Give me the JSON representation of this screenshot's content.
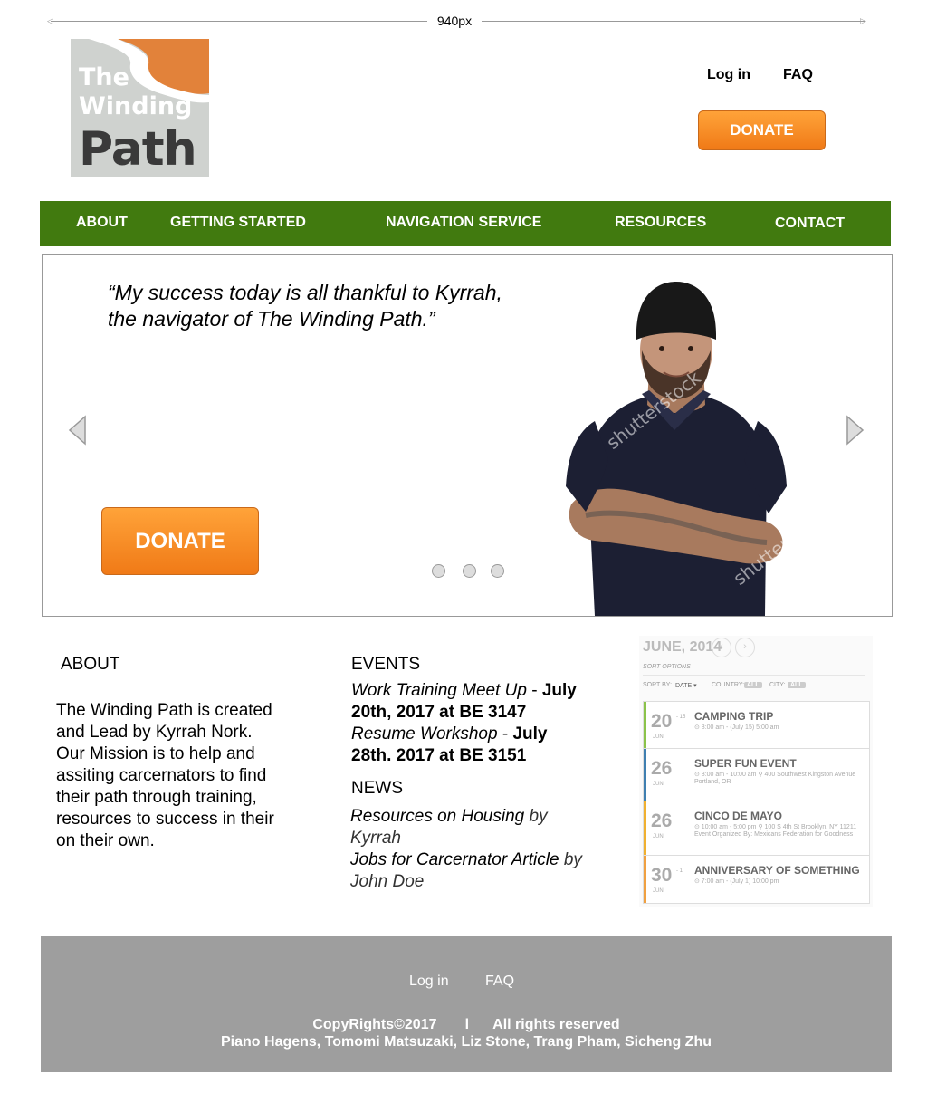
{
  "ruler": {
    "label": "940px"
  },
  "logo": {
    "line1": "The",
    "line2": "Winding",
    "line3": "Path"
  },
  "header": {
    "login": "Log in",
    "faq": "FAQ",
    "donate": "DONATE"
  },
  "nav": {
    "about": "ABOUT",
    "getting_started": "GETTING STARTED",
    "navigation_service": "NAVIGATION SERVICE",
    "resources": "RESOURCES",
    "contact": "CONTACT"
  },
  "hero": {
    "quote_line1": "“My success today is all thankful to Kyrrah,",
    "quote_line2": "the navigator of The Winding Path.”",
    "donate": "DONATE",
    "watermark": "shutterstock"
  },
  "about": {
    "heading": "ABOUT",
    "body": "The Winding Path is created and Lead by Kyrrah Nork.",
    "mission": "Our Mission is to help and assiting carcernators to find their path through training, resources to success in their on their own."
  },
  "events": {
    "heading": "EVENTS",
    "items": [
      {
        "name": "Work Training Meet Up",
        "sep": " - ",
        "when": "July 20th, 2017 at BE 3147"
      },
      {
        "name": "Resume Workshop",
        "sep": " - ",
        "when": "July 28th. 2017 at BE 3151"
      }
    ]
  },
  "news": {
    "heading": "NEWS",
    "items": [
      {
        "title": "Resources on Housing",
        "by": " by Kyrrah"
      },
      {
        "title": "Jobs for Carcernator Article",
        "by": " by John Doe"
      }
    ]
  },
  "calendar": {
    "month": "JUNE, 2014",
    "sort_options": "SORT OPTIONS",
    "sort_by": "SORT BY:",
    "sort_value": "DATE ▾",
    "country": "COUNTRY:",
    "country_value": "ALL",
    "city": "CITY:",
    "city_value": "ALL",
    "events": [
      {
        "day": "20",
        "day2": "- 15",
        "month": "JUN",
        "title": "CAMPING TRIP",
        "meta": "⊙ 8:00 am - (July 15) 5:00 am",
        "color": "#8bc34a"
      },
      {
        "day": "26",
        "day2": "",
        "month": "JUN",
        "title": "SUPER FUN EVENT",
        "meta": "⊙ 8:00 am - 10:00 am  ⚲ 400 Southwest Kingston Avenue Portland, OR",
        "color": "#3f7fb0"
      },
      {
        "day": "26",
        "day2": "",
        "month": "JUN",
        "title": "CINCO DE MAYO",
        "meta": "⊙ 10:00 am - 5:00 pm  ⚲ 100 S 4th St Brooklyn, NY 11211  Event Organized By: Mexicans Federation for Goodness",
        "color": "#f0b030"
      },
      {
        "day": "30",
        "day2": "- 1",
        "month": "JUN",
        "title": "ANNIVERSARY OF SOMETHING",
        "meta": "⊙ 7:00 am - (July 1) 10:00 pm",
        "color": "#f0a040"
      }
    ]
  },
  "footer": {
    "login": "Log in",
    "faq": "FAQ",
    "copyright": "CopyRights©2017       l      All rights reserved",
    "names": "Piano Hagens, Tomomi Matsuzaki, Liz Stone, Trang Pham, Sicheng Zhu"
  }
}
